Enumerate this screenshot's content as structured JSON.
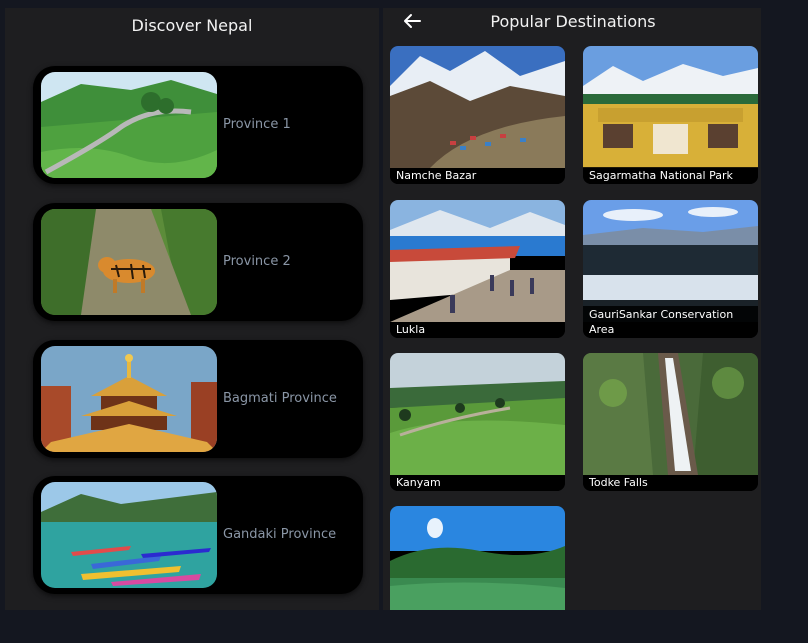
{
  "left_screen": {
    "title": "Discover Nepal",
    "provinces": [
      {
        "label": "Province 1",
        "image": "tea-garden-road"
      },
      {
        "label": "Province 2",
        "image": "tiger-forest"
      },
      {
        "label": "Bagmati Province",
        "image": "pashupatinath-temple"
      },
      {
        "label": "Gandaki Province",
        "image": "phewa-lake-boats"
      }
    ]
  },
  "right_screen": {
    "back_icon": "arrow-left-icon",
    "title": "Popular Destinations",
    "destinations": [
      {
        "name": "Namche Bazar"
      },
      {
        "name": "Sagarmatha National Park"
      },
      {
        "name": "Lukla"
      },
      {
        "name": "GauriSankar Conservation Area"
      },
      {
        "name": "Kanyam"
      },
      {
        "name": "Todke Falls"
      },
      {
        "name": ""
      }
    ]
  },
  "colors": {
    "background": "#141720",
    "panel": "#1e1e20",
    "card": "#000000",
    "province_label": "#8a96a6"
  }
}
